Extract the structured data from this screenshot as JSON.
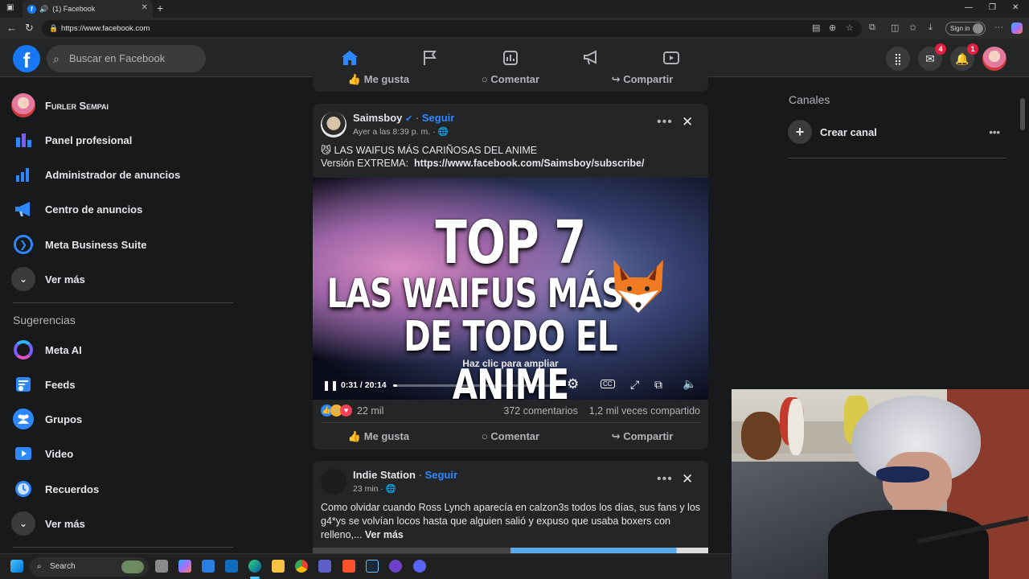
{
  "browser": {
    "tab_title": "(1) Facebook",
    "url": "https://www.facebook.com",
    "signin_label": "Sign in"
  },
  "fb_header": {
    "search_placeholder": "Buscar en Facebook",
    "messenger_badge": "4",
    "notifications_badge": "1"
  },
  "left_sidebar": {
    "profile_name": "Furler Sempai",
    "items": [
      {
        "label": "Panel profesional",
        "icon": "chart-bars-icon"
      },
      {
        "label": "Administrador de anuncios",
        "icon": "ads-chart-icon"
      },
      {
        "label": "Centro de anuncios",
        "icon": "megaphone-icon"
      },
      {
        "label": "Meta Business Suite",
        "icon": "business-suite-icon"
      },
      {
        "label": "Ver más",
        "icon": "chevron-down-icon"
      }
    ],
    "suggestions_title": "Sugerencias",
    "suggestions": [
      {
        "label": "Meta AI",
        "icon": "meta-ai-icon"
      },
      {
        "label": "Feeds",
        "icon": "feeds-icon"
      },
      {
        "label": "Grupos",
        "icon": "groups-icon"
      },
      {
        "label": "Video",
        "icon": "video-icon"
      },
      {
        "label": "Recuerdos",
        "icon": "clock-icon"
      },
      {
        "label": "Ver más",
        "icon": "chevron-down-icon"
      }
    ]
  },
  "top_post_actions": {
    "like": "Me gusta",
    "comment": "Comentar",
    "share": "Compartir"
  },
  "post1": {
    "author": "Saimsboy",
    "follow": "Seguir",
    "time": "Ayer a las 8:39 p. m. ·",
    "line1": "LAS WAIFUS MÁS CARIÑOSAS DEL ANIME",
    "line2_prefix": "Versión EXTREMA:",
    "line2_link": "https://www.facebook.com/Saimsboy/subscribe/",
    "video_title_1": "TOP 7",
    "video_title_2": "LAS WAIFUS MÁS",
    "video_title_3": "DE TODO EL ANIME",
    "video_hint": "Haz clic para ampliar",
    "video_time": "0:31 / 20:14",
    "video_progress": 0.026,
    "reactions": "22 mil",
    "comments": "372 comentarios",
    "shares": "1,2 mil veces compartido",
    "like": "Me gusta",
    "comment": "Comentar",
    "share": "Compartir"
  },
  "post2": {
    "author": "Indie Station",
    "follow": "Seguir",
    "time": "23 min ·",
    "text": "Como olvidar cuando Ross Lynch aparecía en calzon3s todos los días, sus fans y los g4*ys se volvían locos hasta que alguien salió y expuso que usaba boxers con relleno,...",
    "see_more": "Ver más"
  },
  "right_sidebar": {
    "title": "Canales",
    "create_channel": "Crear canal"
  },
  "taskbar": {
    "search_label": "Search"
  }
}
